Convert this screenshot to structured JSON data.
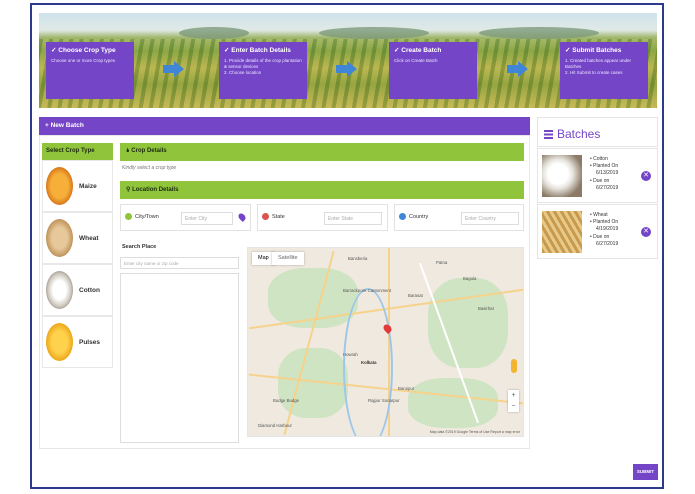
{
  "steps": [
    {
      "title": "Choose Crop Type",
      "desc": [
        "Choose one or more Crop types"
      ]
    },
    {
      "title": "Enter Batch Details",
      "desc": [
        "1. Provide details of the crop plantation & sensor devices",
        "2. Choose location"
      ]
    },
    {
      "title": "Create Batch",
      "desc": [
        "Click on Create Batch"
      ]
    },
    {
      "title": "Submit Batches",
      "desc": [
        "1. Created batches appear under Batches",
        "2. Hit Submit to create cases"
      ]
    }
  ],
  "new_batch": {
    "label": "+ New Batch"
  },
  "crop_select": {
    "header": "Select Crop Type",
    "items": [
      {
        "name": "Maize",
        "color": "#e9901c"
      },
      {
        "name": "Wheat",
        "color": "#c89a55"
      },
      {
        "name": "Cotton",
        "color": "#d8d3cb"
      },
      {
        "name": "Pulses",
        "color": "#f2b41d"
      }
    ]
  },
  "crop_details": {
    "header": "Crop Details",
    "hint": "Kindly select a crop type"
  },
  "location": {
    "header": "Location Details",
    "city_label": "City/Town",
    "city_placeholder": "Enter City",
    "state_label": "State",
    "state_placeholder": "Enter State",
    "country_label": "Country",
    "country_placeholder": "Enter Country"
  },
  "search": {
    "label": "Search Place",
    "placeholder": "Enter city name or zip code"
  },
  "map": {
    "tabs": [
      "Map",
      "Satellite"
    ],
    "labels": [
      "Patna",
      "Barrackpore Cantonment",
      "Barasat",
      "Howrah",
      "Kolkata",
      "Rajpur Sonarpur",
      "Baruipur",
      "Budge Budge",
      "Bansberia",
      "Basirhat",
      "Bagula",
      "Diamond Harbour"
    ],
    "footer": "Map data ©2019 Google  Terms of Use  Report a map error"
  },
  "batches": {
    "title": "Batches",
    "cards": [
      {
        "crop": "Cotton",
        "planted_label": "Planted On",
        "planted": "6/13/2019",
        "due_label": "Due on",
        "due": "6/27/2019"
      },
      {
        "crop": "Wheat",
        "planted_label": "Planted On",
        "planted": "4/19/2019",
        "due_label": "Due on",
        "due": "6/27/2019"
      }
    ]
  },
  "submit_label": "SUBMIT",
  "colors": {
    "accent": "#7446c7",
    "green": "#8fc43b",
    "border": "#2b3a8c"
  }
}
